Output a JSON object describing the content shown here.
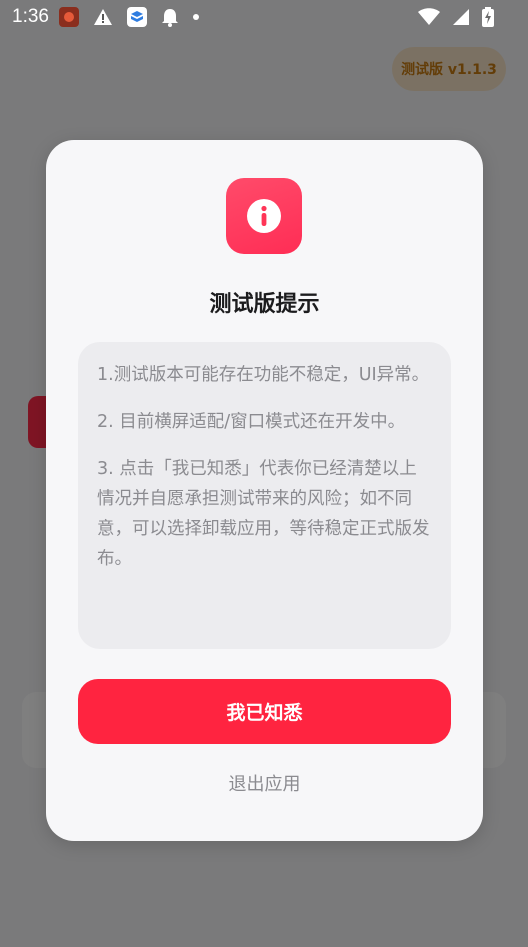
{
  "status_bar": {
    "time": "1:36",
    "left_icons": [
      "app-icon",
      "warning-icon",
      "box-app-icon",
      "bell-icon",
      "dot-icon"
    ],
    "right_icons": [
      "wifi-icon",
      "signal-icon",
      "battery-charging-icon"
    ]
  },
  "background": {
    "version_chip": "测试版 v1.1.3"
  },
  "dialog": {
    "icon": "info-icon",
    "title": "测试版提示",
    "notices": [
      "1.测试版本可能存在功能不稳定，UI异常。",
      "2. 目前横屏适配/窗口模式还在开发中。",
      "3. 点击「我已知悉」代表你已经清楚以上情况并自愿承担测试带来的风险；如不同意，可以选择卸载应用，等待稳定正式版发布。"
    ],
    "confirm_label": "我已知悉",
    "exit_label": "退出应用"
  },
  "colors": {
    "accent": "#ff2440",
    "icon_gradient_start": "#ff4b6a",
    "icon_gradient_end": "#ff2d55",
    "dialog_bg": "#f7f7f9",
    "notice_bg": "#ececef",
    "muted_text": "#8b8b90"
  }
}
